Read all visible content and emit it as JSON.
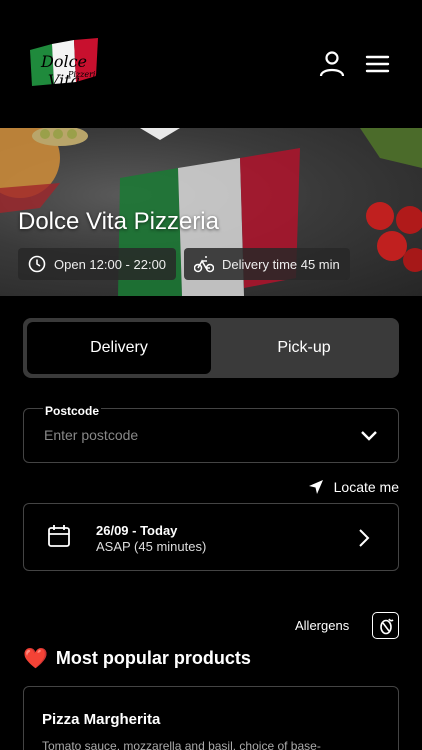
{
  "header": {
    "logo_text": "Dolce Vita",
    "logo_sub": "Pizzeria",
    "icons": [
      "user-icon",
      "menu-icon"
    ]
  },
  "hero": {
    "title": "Dolce Vita Pizzeria",
    "hours": "Open 12:00 - 22:00",
    "delivery_time": "Delivery time 45 min"
  },
  "order_mode": {
    "options": [
      "Delivery",
      "Pick-up"
    ],
    "selected": "Delivery"
  },
  "postcode": {
    "label": "Postcode",
    "placeholder": "Enter postcode",
    "value": ""
  },
  "locate": {
    "label": "Locate me"
  },
  "schedule": {
    "date": "26/09 - Today",
    "time": "ASAP (45 minutes)"
  },
  "allergens": {
    "label": "Allergens"
  },
  "popular": {
    "title": "Most popular products",
    "emoji": "❤️",
    "products": [
      {
        "name": "Pizza Margherita",
        "description": "Tomato sauce, mozzarella and basil, choice of base-"
      }
    ]
  },
  "colors": {
    "background": "#000000",
    "surface": "#3a3a3a",
    "border": "#444444",
    "flag_green": "#1f8a3c",
    "flag_red": "#c8102e"
  }
}
